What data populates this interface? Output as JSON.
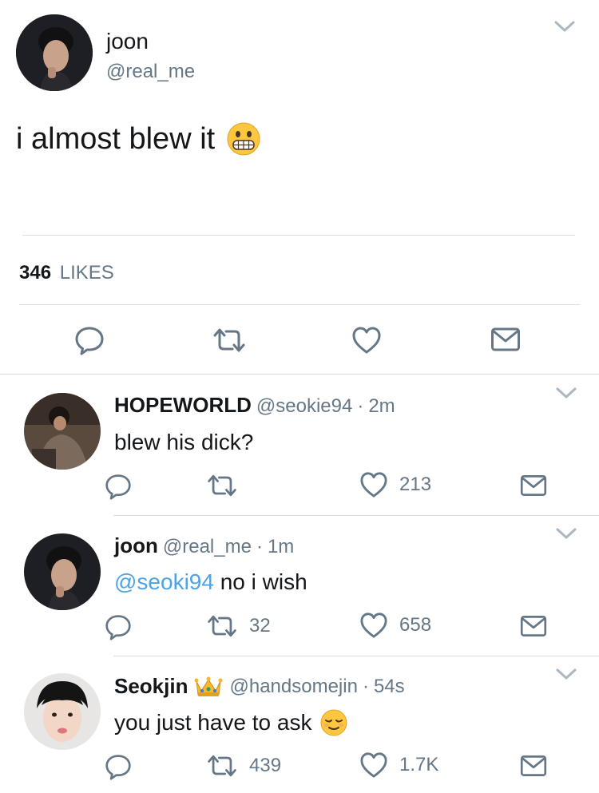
{
  "main_tweet": {
    "display_name": "joon",
    "handle": "@real_me",
    "text": "i almost blew it",
    "likes_count": "346",
    "likes_label": "LIKES"
  },
  "replies": [
    {
      "display_name": "HOPEWORLD",
      "handle": "@seokie94",
      "separator": "·",
      "time": "2m",
      "text": "blew his dick?",
      "retweets": "",
      "likes": "213"
    },
    {
      "display_name": "joon",
      "handle": "@real_me",
      "separator": "·",
      "time": "1m",
      "mention": "@seoki94",
      "text": "no i wish",
      "retweets": "32",
      "likes": "658"
    },
    {
      "display_name": "Seokjin",
      "handle": "@handsomejin",
      "separator": "·",
      "time": "54s",
      "text": "you just have to ask",
      "retweets": "439",
      "likes": "1.7K"
    }
  ],
  "colors": {
    "text": "#14171a",
    "secondary": "#657786",
    "mention": "#4da3e4",
    "divider": "#d9dde1"
  },
  "icons": [
    "reply-icon",
    "retweet-icon",
    "heart-icon",
    "direct-message-icon",
    "chevron-down-icon",
    "grimacing-emoji",
    "relieved-emoji",
    "crown-emoji"
  ]
}
